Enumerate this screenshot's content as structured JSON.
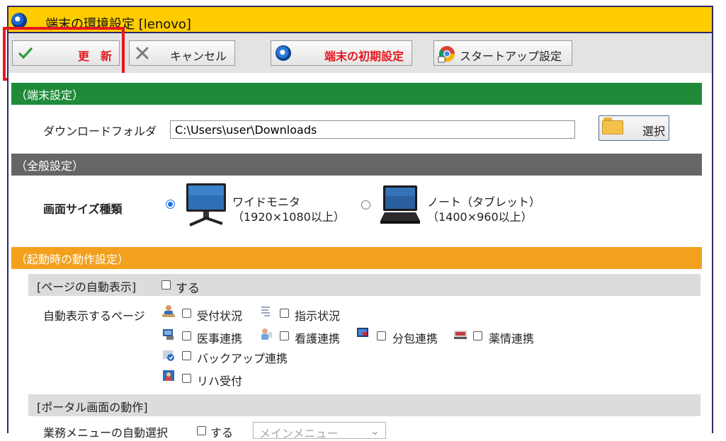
{
  "window": {
    "title": "端末の環境設定 [lenovo]"
  },
  "toolbar": {
    "update": "更　新",
    "cancel": "キャンセル",
    "initial_settings": "端末の初期設定",
    "startup_settings": "スタートアップ設定"
  },
  "colors": {
    "title_bar": "#ffcc00",
    "terminal_header": "#1f8b3a",
    "general_header": "#666666",
    "startup_header": "#f2a01e",
    "highlight": "#e8171f",
    "accent_text": "#e8171f"
  },
  "terminal": {
    "header": "（端末設定）",
    "download_folder_label": "ダウンロードフォルダ",
    "download_folder_value": "C:\\Users\\user\\Downloads",
    "select_button": "選択"
  },
  "general": {
    "header": "（全般設定）",
    "screen_size_label": "画面サイズ種類",
    "options": [
      {
        "line1": "ワイドモニタ",
        "line2": "（1920×1080以上）",
        "selected": true
      },
      {
        "line1": "ノート（タブレット）",
        "line2": "（1400×960以上）",
        "selected": false
      }
    ]
  },
  "startup": {
    "header": "（起動時の動作設定）",
    "auto_page_section": "[ページの自動表示]",
    "auto_page_do": "する",
    "auto_page_label": "自動表示するページ",
    "pages": [
      {
        "label": "受付状況",
        "icon": "reception-icon"
      },
      {
        "label": "指示状況",
        "icon": "instruction-icon"
      },
      {
        "label": "医事連携",
        "icon": "medical-icon"
      },
      {
        "label": "看護連携",
        "icon": "nursing-icon"
      },
      {
        "label": "分包連携",
        "icon": "packaging-icon"
      },
      {
        "label": "薬情連携",
        "icon": "drug-info-icon"
      },
      {
        "label": "バックアップ連携",
        "icon": "backup-icon"
      },
      {
        "label": "リハ受付",
        "icon": "rehab-icon"
      }
    ],
    "portal_section": "[ポータル画面の動作]",
    "portal_menu_label": "業務メニューの自動選択",
    "portal_do": "する",
    "portal_select_value": "メインメニュー"
  }
}
